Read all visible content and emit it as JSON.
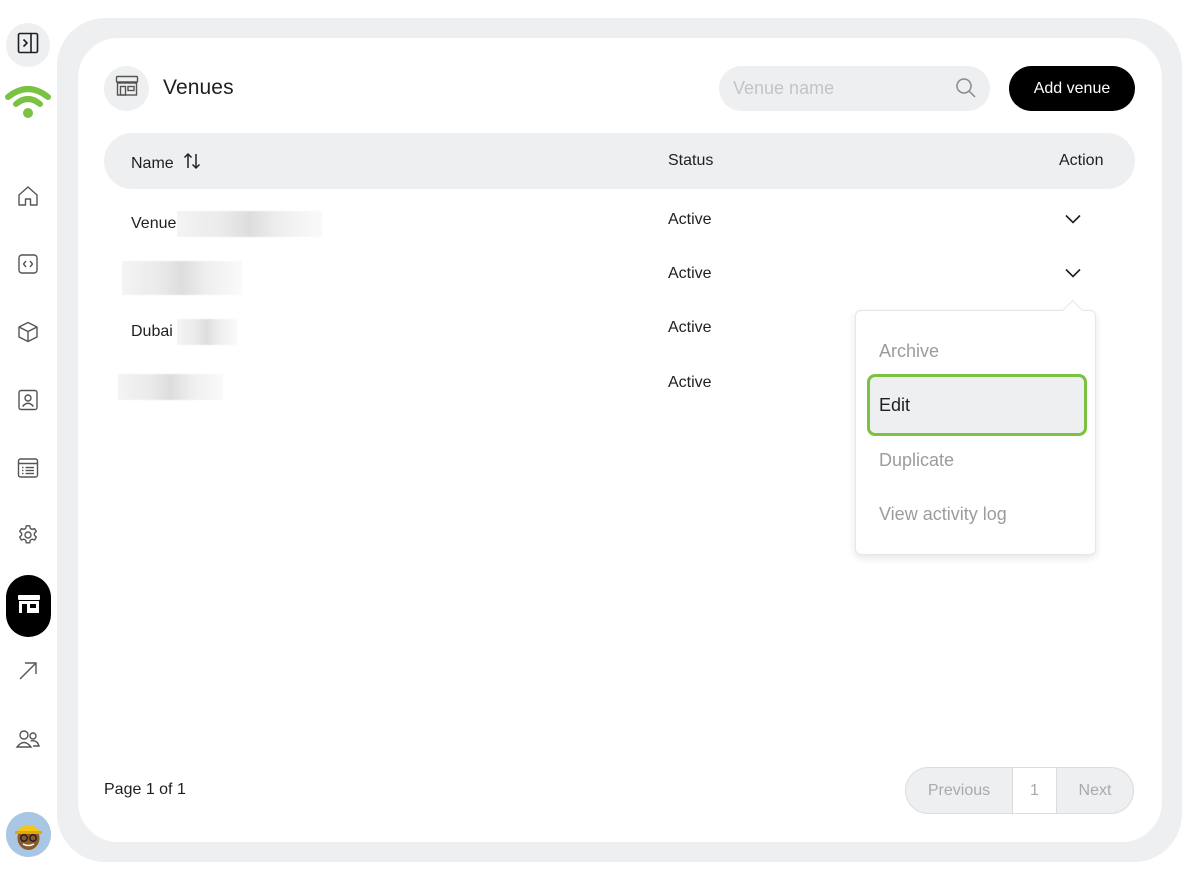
{
  "sidebar": {
    "toggle_icon": "sidebar-expand-icon",
    "logo_icon": "wifi-logo-icon",
    "logo_color": "#7bc142",
    "items": [
      {
        "name": "home",
        "icon": "home-icon"
      },
      {
        "name": "code",
        "icon": "code-icon"
      },
      {
        "name": "products",
        "icon": "cube-icon"
      },
      {
        "name": "contacts",
        "icon": "contact-card-icon"
      },
      {
        "name": "reports",
        "icon": "list-document-icon"
      },
      {
        "name": "settings",
        "icon": "gear-icon"
      },
      {
        "name": "venues",
        "icon": "storefront-icon",
        "active": true
      },
      {
        "name": "analytics",
        "icon": "arrow-up-right-icon"
      },
      {
        "name": "users",
        "icon": "users-icon"
      }
    ],
    "avatar": "user-avatar"
  },
  "header": {
    "title": "Venues",
    "title_icon": "storefront-icon",
    "search_placeholder": "Venue name",
    "add_button": "Add venue"
  },
  "table": {
    "columns": {
      "name": "Name",
      "status": "Status",
      "action": "Action"
    },
    "rows": [
      {
        "name": "Venue",
        "status": "Active"
      },
      {
        "name": "",
        "status": "Active"
      },
      {
        "name": "Dubai",
        "status": "Active"
      },
      {
        "name": "",
        "status": "Active"
      }
    ]
  },
  "dropdown": {
    "items": [
      "Archive",
      "Edit",
      "Duplicate",
      "View activity log"
    ],
    "selected": "Edit",
    "highlight_color": "#7bc142"
  },
  "pagination": {
    "label": "Page 1 of 1",
    "previous": "Previous",
    "current": "1",
    "next": "Next"
  }
}
